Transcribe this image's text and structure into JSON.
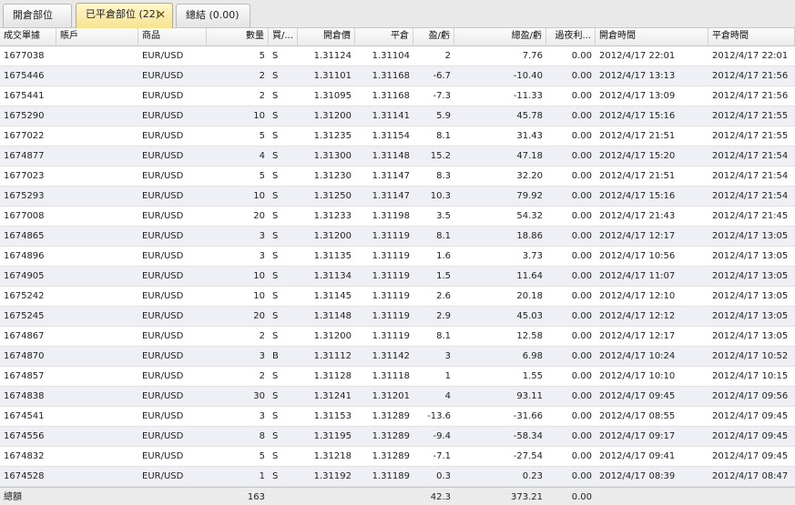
{
  "tabs": [
    {
      "label": "開倉部位"
    },
    {
      "label": "已平倉部位 (22)"
    },
    {
      "label": "總結 (0.00)"
    }
  ],
  "close_glyph": "✕",
  "columns": [
    "成交單據",
    "賬戶",
    "商品",
    "數量",
    "買/...",
    "開倉價",
    "平倉",
    "盈/虧",
    "總盈/虧",
    "過夜利...",
    "開倉時間",
    "平倉時間"
  ],
  "rows": [
    [
      "1677038",
      "",
      "EUR/USD",
      "5",
      "S",
      "1.31124",
      "1.31104",
      "2",
      "7.76",
      "0.00",
      "2012/4/17 22:01",
      "2012/4/17 22:01"
    ],
    [
      "1675446",
      "",
      "EUR/USD",
      "2",
      "S",
      "1.31101",
      "1.31168",
      "-6.7",
      "-10.40",
      "0.00",
      "2012/4/17 13:13",
      "2012/4/17 21:56"
    ],
    [
      "1675441",
      "",
      "EUR/USD",
      "2",
      "S",
      "1.31095",
      "1.31168",
      "-7.3",
      "-11.33",
      "0.00",
      "2012/4/17 13:09",
      "2012/4/17 21:56"
    ],
    [
      "1675290",
      "",
      "EUR/USD",
      "10",
      "S",
      "1.31200",
      "1.31141",
      "5.9",
      "45.78",
      "0.00",
      "2012/4/17 15:16",
      "2012/4/17 21:55"
    ],
    [
      "1677022",
      "",
      "EUR/USD",
      "5",
      "S",
      "1.31235",
      "1.31154",
      "8.1",
      "31.43",
      "0.00",
      "2012/4/17 21:51",
      "2012/4/17 21:55"
    ],
    [
      "1674877",
      "",
      "EUR/USD",
      "4",
      "S",
      "1.31300",
      "1.31148",
      "15.2",
      "47.18",
      "0.00",
      "2012/4/17 15:20",
      "2012/4/17 21:54"
    ],
    [
      "1677023",
      "",
      "EUR/USD",
      "5",
      "S",
      "1.31230",
      "1.31147",
      "8.3",
      "32.20",
      "0.00",
      "2012/4/17 21:51",
      "2012/4/17 21:54"
    ],
    [
      "1675293",
      "",
      "EUR/USD",
      "10",
      "S",
      "1.31250",
      "1.31147",
      "10.3",
      "79.92",
      "0.00",
      "2012/4/17 15:16",
      "2012/4/17 21:54"
    ],
    [
      "1677008",
      "",
      "EUR/USD",
      "20",
      "S",
      "1.31233",
      "1.31198",
      "3.5",
      "54.32",
      "0.00",
      "2012/4/17 21:43",
      "2012/4/17 21:45"
    ],
    [
      "1674865",
      "",
      "EUR/USD",
      "3",
      "S",
      "1.31200",
      "1.31119",
      "8.1",
      "18.86",
      "0.00",
      "2012/4/17 12:17",
      "2012/4/17 13:05"
    ],
    [
      "1674896",
      "",
      "EUR/USD",
      "3",
      "S",
      "1.31135",
      "1.31119",
      "1.6",
      "3.73",
      "0.00",
      "2012/4/17 10:56",
      "2012/4/17 13:05"
    ],
    [
      "1674905",
      "",
      "EUR/USD",
      "10",
      "S",
      "1.31134",
      "1.31119",
      "1.5",
      "11.64",
      "0.00",
      "2012/4/17 11:07",
      "2012/4/17 13:05"
    ],
    [
      "1675242",
      "",
      "EUR/USD",
      "10",
      "S",
      "1.31145",
      "1.31119",
      "2.6",
      "20.18",
      "0.00",
      "2012/4/17 12:10",
      "2012/4/17 13:05"
    ],
    [
      "1675245",
      "",
      "EUR/USD",
      "20",
      "S",
      "1.31148",
      "1.31119",
      "2.9",
      "45.03",
      "0.00",
      "2012/4/17 12:12",
      "2012/4/17 13:05"
    ],
    [
      "1674867",
      "",
      "EUR/USD",
      "2",
      "S",
      "1.31200",
      "1.31119",
      "8.1",
      "12.58",
      "0.00",
      "2012/4/17 12:17",
      "2012/4/17 13:05"
    ],
    [
      "1674870",
      "",
      "EUR/USD",
      "3",
      "B",
      "1.31112",
      "1.31142",
      "3",
      "6.98",
      "0.00",
      "2012/4/17 10:24",
      "2012/4/17 10:52"
    ],
    [
      "1674857",
      "",
      "EUR/USD",
      "2",
      "S",
      "1.31128",
      "1.31118",
      "1",
      "1.55",
      "0.00",
      "2012/4/17 10:10",
      "2012/4/17 10:15"
    ],
    [
      "1674838",
      "",
      "EUR/USD",
      "30",
      "S",
      "1.31241",
      "1.31201",
      "4",
      "93.11",
      "0.00",
      "2012/4/17 09:45",
      "2012/4/17 09:56"
    ],
    [
      "1674541",
      "",
      "EUR/USD",
      "3",
      "S",
      "1.31153",
      "1.31289",
      "-13.6",
      "-31.66",
      "0.00",
      "2012/4/17 08:55",
      "2012/4/17 09:45"
    ],
    [
      "1674556",
      "",
      "EUR/USD",
      "8",
      "S",
      "1.31195",
      "1.31289",
      "-9.4",
      "-58.34",
      "0.00",
      "2012/4/17 09:17",
      "2012/4/17 09:45"
    ],
    [
      "1674832",
      "",
      "EUR/USD",
      "5",
      "S",
      "1.31218",
      "1.31289",
      "-7.1",
      "-27.54",
      "0.00",
      "2012/4/17 09:41",
      "2012/4/17 09:45"
    ],
    [
      "1674528",
      "",
      "EUR/USD",
      "1",
      "S",
      "1.31192",
      "1.31189",
      "0.3",
      "0.23",
      "0.00",
      "2012/4/17 08:39",
      "2012/4/17 08:47"
    ]
  ],
  "totals": [
    "總額",
    "",
    "",
    "163",
    "",
    "",
    "",
    "42.3",
    "373.21",
    "0.00",
    "",
    ""
  ]
}
